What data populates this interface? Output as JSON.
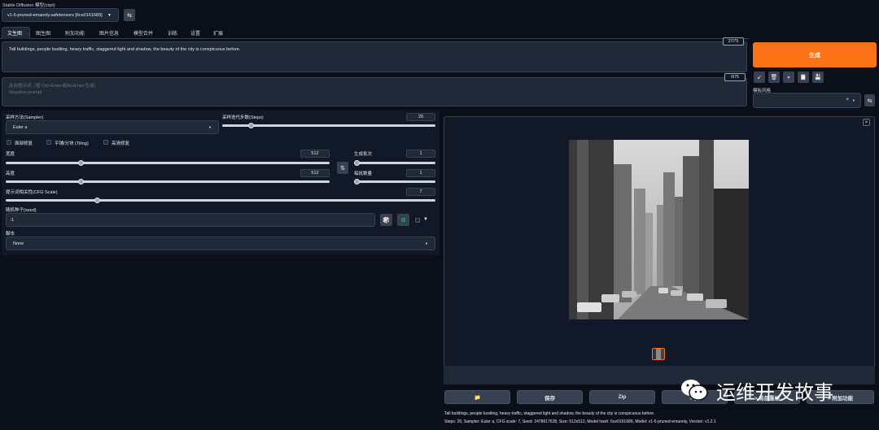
{
  "model": {
    "label": "Stable Diffusion 模型(ckpt)",
    "selected": "v1-5-pruned-emaonly.safetensors [6ce0161689]"
  },
  "tabs": [
    "文生图",
    "图生图",
    "附加功能",
    "图片信息",
    "模型合并",
    "训练",
    "设置",
    "扩展"
  ],
  "prompt": {
    "value": "Tall buildings, people bustling, heavy traffic, staggered light and shadow, the beauty of the city is conspicuous before.",
    "counter": "27/75"
  },
  "negative_prompt": {
    "placeholder_cn": "反向提示词（按 Ctrl+Enter或Alt+Enter生成）",
    "placeholder_en": "Negative prompt",
    "counter": "0/75"
  },
  "generate_label": "生成",
  "style_label": "模板风格",
  "sampler": {
    "label": "采样方法(Sampler)",
    "value": "Euler a"
  },
  "steps": {
    "label": "采样迭代步数(Steps)",
    "value": "20",
    "fraction": 0.13
  },
  "checkboxes": {
    "restore_faces": "面部修复",
    "tiling": "平铺/分块 (Tiling)",
    "hires": "高清修复"
  },
  "width": {
    "label": "宽度",
    "value": "512",
    "fraction": 0.23
  },
  "height": {
    "label": "高度",
    "value": "512",
    "fraction": 0.23
  },
  "batch_count": {
    "label": "生成批次",
    "value": "1",
    "fraction": 0.0
  },
  "batch_size": {
    "label": "每批数量",
    "value": "1",
    "fraction": 0.0
  },
  "cfg": {
    "label": "提示词相关性(CFG Scale)",
    "value": "7",
    "fraction": 0.21
  },
  "seed": {
    "label": "随机种子(seed)",
    "value": "-1"
  },
  "script": {
    "label": "脚本",
    "value": "None"
  },
  "close_symbol": "×",
  "actions": {
    "folder": "📁",
    "save": "保存",
    "zip": "Zip",
    "to_img2img": "> 图",
    "to_inpaint": "> 局部重绘",
    "to_extras": "> 附加功能"
  },
  "generation_info": {
    "prompt": "Tall buildings, people bustling, heavy traffic, staggered light and shadow, the beauty of the city is conspicuous before.",
    "params": "Steps: 20, Sampler: Euler a, CFG scale: 7, Seed: 2478617628, Size: 512x512, Model hash: 6ce0161689, Model: v1-5-pruned-emaonly, Version: v1.2.1"
  },
  "watermark": "运维开发故事",
  "colors": {
    "accent": "#f97316",
    "bg": "#0b0f19",
    "panel": "#1f2937"
  }
}
